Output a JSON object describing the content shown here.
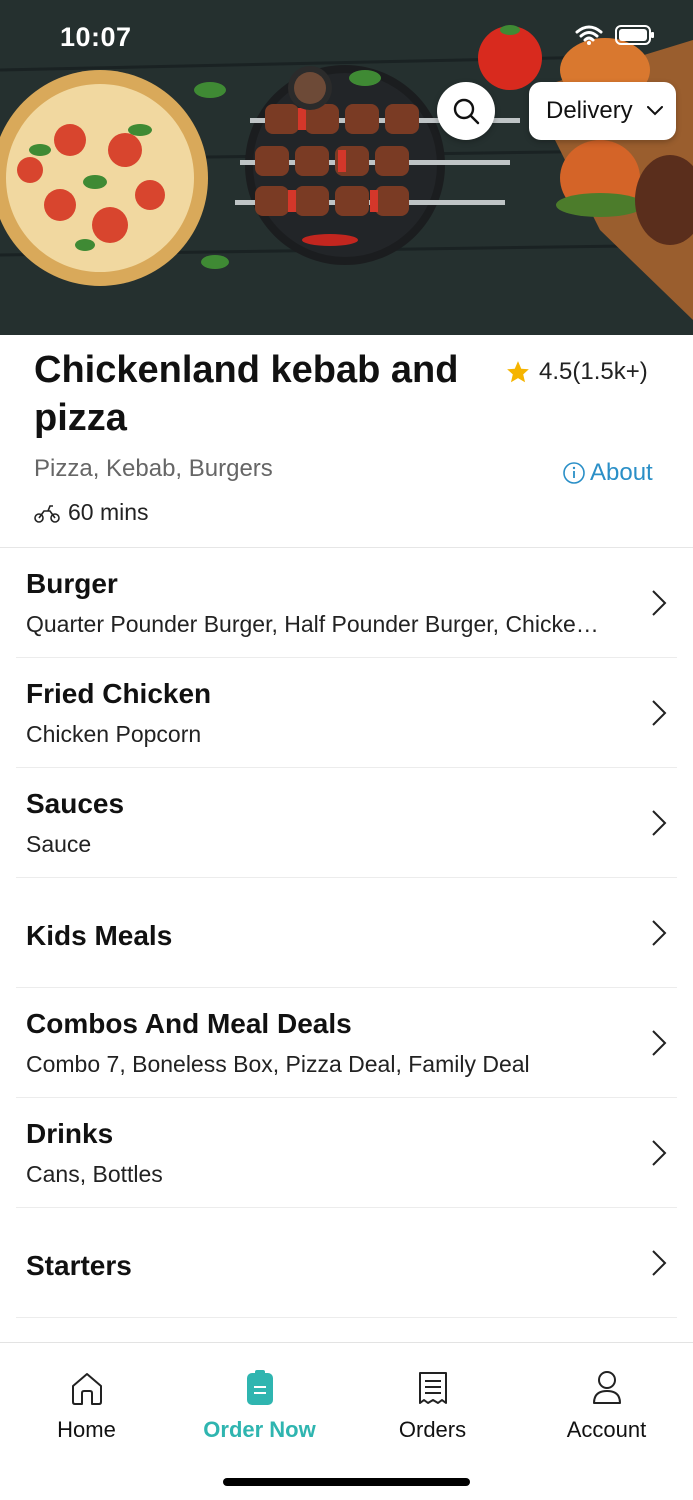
{
  "status_bar": {
    "time": "10:07"
  },
  "hero": {
    "delivery_label": "Delivery"
  },
  "restaurant": {
    "name": "Chickenland kebab and pizza",
    "rating": "4.5(1.5k+)",
    "cuisines": "Pizza, Kebab, Burgers",
    "about_label": "About",
    "eta": "60 mins"
  },
  "categories": [
    {
      "title": "Burger",
      "subtitle": "Quarter Pounder Burger, Half Pounder Burger, Chicke…"
    },
    {
      "title": "Fried Chicken",
      "subtitle": "Chicken Popcorn"
    },
    {
      "title": "Sauces",
      "subtitle": "Sauce"
    },
    {
      "title": "Kids Meals",
      "subtitle": ""
    },
    {
      "title": "Combos And Meal Deals",
      "subtitle": "Combo 7, Boneless Box, Pizza Deal, Family Deal"
    },
    {
      "title": "Drinks",
      "subtitle": "Cans, Bottles"
    },
    {
      "title": "Starters",
      "subtitle": ""
    }
  ],
  "tabbar": {
    "home": "Home",
    "order_now": "Order Now",
    "orders": "Orders",
    "account": "Account",
    "active_color": "#2fb5b0"
  },
  "colors": {
    "accent": "#2fb5b0",
    "link": "#2a8fc7",
    "star": "#f5b400"
  }
}
